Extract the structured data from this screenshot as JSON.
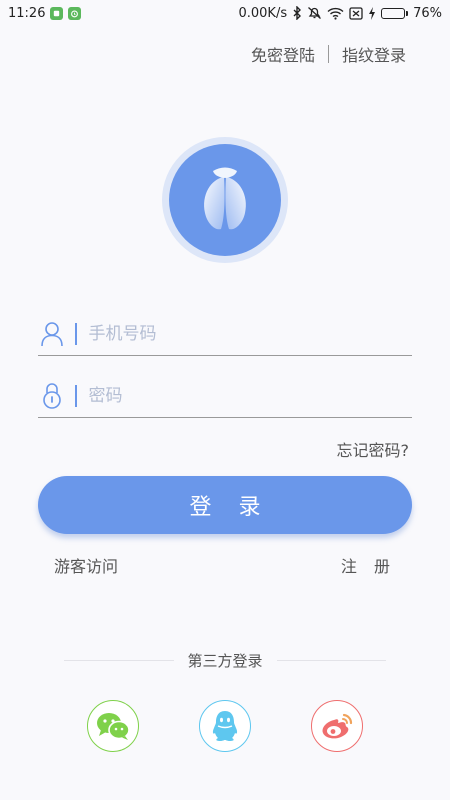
{
  "status_bar": {
    "time": "11:26",
    "network_speed": "0.00K/s",
    "battery_percent": "76%",
    "battery_level": 0.76,
    "icons": [
      "app-icon",
      "alarm-app-icon",
      "bluetooth-icon",
      "silent-icon",
      "wifi-icon",
      "no-sim-icon",
      "charging-icon",
      "battery-icon"
    ]
  },
  "header": {
    "password_free_login": "免密登陆",
    "fingerprint_login": "指纹登录"
  },
  "logo": {
    "icon": "cicada-logo-icon"
  },
  "form": {
    "phone_placeholder": "手机号码",
    "password_placeholder": "密码",
    "phone_value": "",
    "password_value": "",
    "user_icon": "user-icon",
    "lock_icon": "lock-icon"
  },
  "forgot_password": "忘记密码?",
  "login_button": "登 录",
  "guest_visit": "游客访问",
  "register": "注 册",
  "third_party": {
    "label": "第三方登录",
    "items": [
      {
        "icon": "wechat-icon",
        "color": "#7fd14a"
      },
      {
        "icon": "qq-icon",
        "color": "#5ec7ef"
      },
      {
        "icon": "weibo-icon",
        "color": "#ef6e6e"
      }
    ]
  },
  "colors": {
    "accent": "#6a97ea",
    "background": "#f9f9fc"
  }
}
